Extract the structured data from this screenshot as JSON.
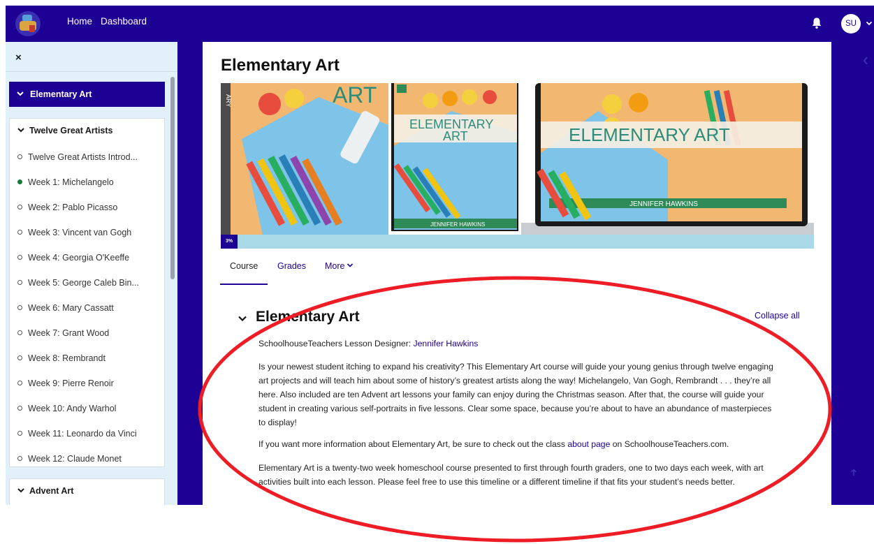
{
  "topbar": {
    "home_label": "Home",
    "dashboard_label": "Dashboard",
    "avatar_initials": "SU",
    "bg_color": "#1d0094"
  },
  "drawer": {
    "close_label": "×",
    "course_title": "Elementary Art",
    "sections": [
      {
        "title": "Twelve Great Artists",
        "items": [
          {
            "label": "Twelve Great Artists Introd...",
            "completed": false
          },
          {
            "label": "Week 1: Michelangelo",
            "completed": true
          },
          {
            "label": "Week 2: Pablo Picasso",
            "completed": false
          },
          {
            "label": "Week 3: Vincent van Gogh",
            "completed": false
          },
          {
            "label": "Week 4: Georgia O'Keeffe",
            "completed": false
          },
          {
            "label": "Week 5: George Caleb Bin...",
            "completed": false
          },
          {
            "label": "Week 6: Mary Cassatt",
            "completed": false
          },
          {
            "label": "Week 7: Grant Wood",
            "completed": false
          },
          {
            "label": "Week 8: Rembrandt",
            "completed": false
          },
          {
            "label": "Week 9: Pierre Renoir",
            "completed": false
          },
          {
            "label": "Week 10: Andy Warhol",
            "completed": false
          },
          {
            "label": "Week 11: Leonardo da Vinci",
            "completed": false
          },
          {
            "label": "Week 12: Claude Monet",
            "completed": false
          }
        ]
      },
      {
        "title": "Advent Art",
        "items": []
      }
    ]
  },
  "main": {
    "page_title": "Elementary Art",
    "banner": {
      "book_top_text": "ART",
      "book_title_line1": "ELEMENTARY",
      "book_title_line2": "ART",
      "book_author": "JENNIFER HAWKINS",
      "laptop_title": "ELEMENTARY ART",
      "laptop_author": "JENNIFER HAWKINS",
      "spine_text": "ARY"
    },
    "progress_label": "3%",
    "progress_percent": 3,
    "tabs": [
      {
        "label": "Course",
        "active": true
      },
      {
        "label": "Grades",
        "active": false
      },
      {
        "label": "More",
        "active": false
      }
    ],
    "section_title": "Elementary Art",
    "collapse_all_label": "Collapse all",
    "designer_prefix": "SchoolhouseTeachers Lesson Designer: ",
    "designer_name": "Jennifer Hawkins",
    "paragraph1": "Is your newest student itching to expand his creativity? This Elementary Art course will guide your young genius through twelve engaging art projects and will teach him about some of history’s greatest artists along the way! Michelangelo, Van Gogh, Rembrandt . . . they’re all here. Also included are ten Advent art lessons your family can enjoy during the Christmas season. After that, the course will guide your student in creating various self-portraits in five lessons. Clear some space, because you’re about to have an abundance of masterpieces to display!",
    "paragraph2_prefix": "If you want more information about Elementary Art, be sure to check out the class ",
    "paragraph2_link": "about page",
    "paragraph2_suffix": " on SchoolhouseTeachers.com.",
    "paragraph3": "Elementary Art is a twenty-two week homeschool course presented to first through fourth graders, one to two days each week, with art activities built into each lesson. Please feel free to use this timeline or a different timeline if that fits your student’s needs better."
  },
  "colors": {
    "accent": "#1d0094",
    "drawer_bg": "#e2f0f9",
    "progress_track": "#a9d8e6",
    "annotation_red": "#ee1c24",
    "completed_dot": "#1a7a3a"
  },
  "icons": [
    "bell-icon",
    "chevron-down-icon",
    "close-icon",
    "chevron-left-icon",
    "arrow-up-icon"
  ]
}
